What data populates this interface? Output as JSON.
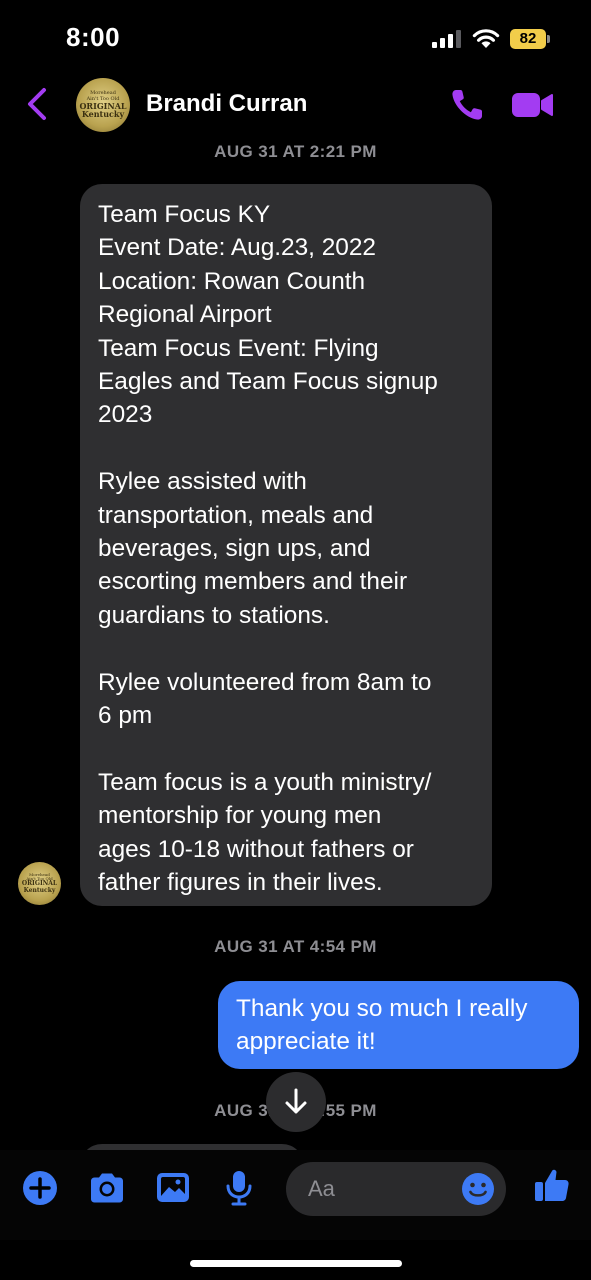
{
  "status_bar": {
    "time": "8:00",
    "battery_level": "82",
    "battery_color": "#f2cd4a"
  },
  "header": {
    "contact_name": "Brandi Curran",
    "avatar_text": [
      "Morehead",
      "Ain't Too Old",
      "ORIGINAL",
      "Kentucky"
    ],
    "accent_color": "#a33cf2",
    "icons": [
      "back-chevron-icon",
      "phone-icon",
      "video-camera-icon"
    ]
  },
  "messages": {
    "timestamp_1": "AUG 31 AT 2:21 PM",
    "incoming_1": "Team Focus KY\nEvent Date: Aug.23, 2022\nLocation: Rowan Counth\nRegional Airport\nTeam Focus Event: Flying\nEagles and Team Focus signup\n2023\n\nRylee assisted with\ntransportation, meals and\nbeverages, sign ups, and\nescorting members and their\nguardians to stations.\n\nRylee volunteered from 8am to\n6 pm\n\nTeam focus is a youth ministry/\nmentorship for young men\nages 10-18 without fathers or\nfather figures in their lives.",
    "timestamp_2": "AUG 31 AT 4:54 PM",
    "outgoing_1": "Thank you so much I really\nappreciate it!",
    "timestamp_3": "AUG 31 AT 4:55 PM",
    "outgoing_color": "#3d7af5",
    "incoming_color": "#2f2f31"
  },
  "composer": {
    "placeholder": "Aa",
    "icons": [
      "plus-circle-icon",
      "camera-icon",
      "photo-icon",
      "microphone-icon",
      "emoji-icon",
      "thumbs-up-icon"
    ],
    "accent_color": "#3d7af5"
  }
}
